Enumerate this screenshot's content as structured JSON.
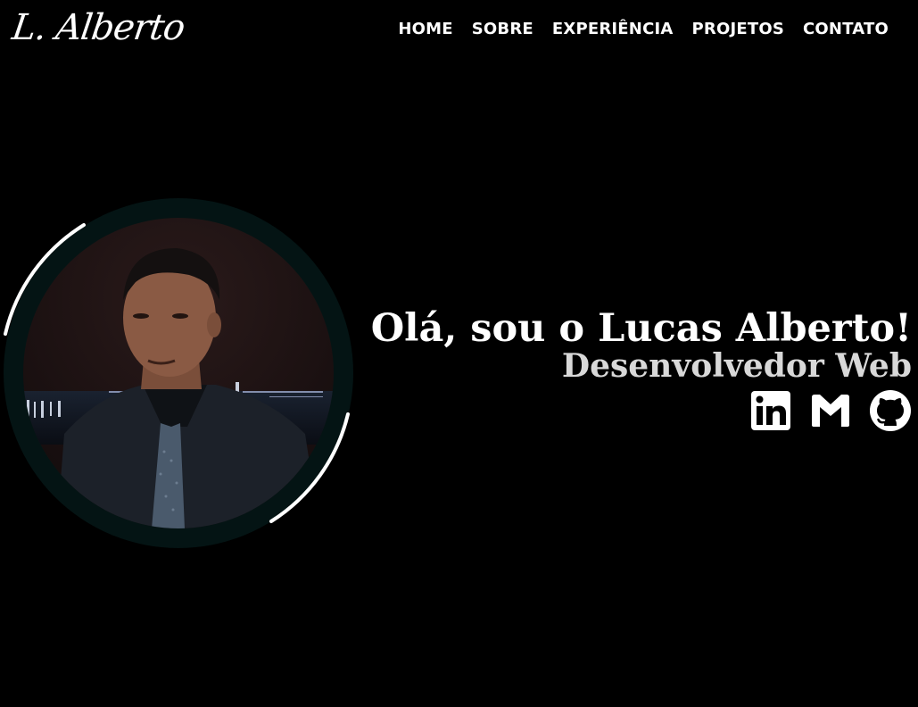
{
  "header": {
    "logo": "L. Alberto",
    "nav": [
      {
        "label": "HOME"
      },
      {
        "label": "SOBRE"
      },
      {
        "label": "EXPERIÊNCIA"
      },
      {
        "label": "PROJETOS"
      },
      {
        "label": "CONTATO"
      }
    ]
  },
  "hero": {
    "title": "Olá, sou o Lucas Alberto!",
    "subtitle": "Desenvolvedor Web",
    "socials": [
      {
        "icon": "linkedin-icon"
      },
      {
        "icon": "gmail-icon"
      },
      {
        "icon": "github-icon"
      }
    ]
  },
  "colors": {
    "background": "#000000",
    "text": "#ffffff",
    "subtitle": "#d8d8d8",
    "ring": "#041414"
  }
}
